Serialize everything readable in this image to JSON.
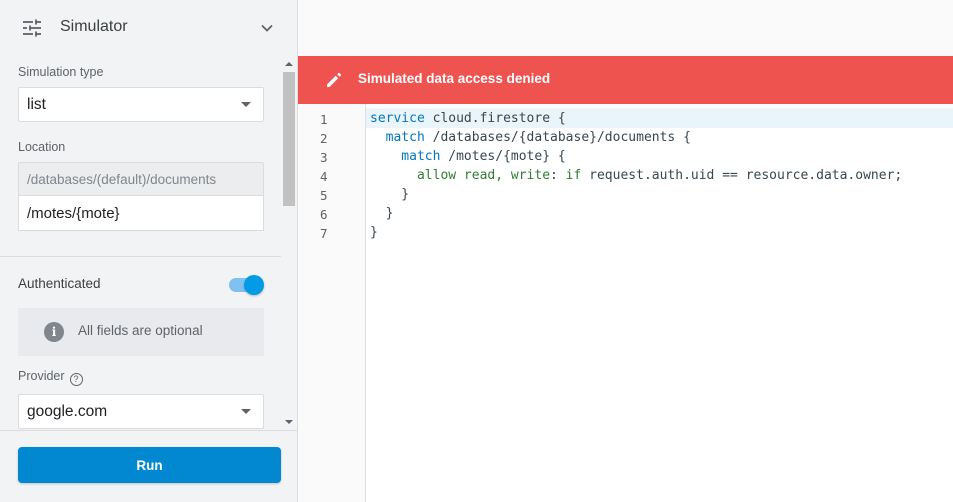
{
  "simulator": {
    "title": "Simulator",
    "simulation_type_label": "Simulation type",
    "simulation_type_value": "list",
    "location_label": "Location",
    "location_prefix": "/databases/(default)/documents",
    "location_path": "/motes/{mote}",
    "authenticated_label": "Authenticated",
    "authenticated": true,
    "optional_note": "All fields are optional",
    "provider_label": "Provider",
    "provider_value": "google.com",
    "run_label": "Run"
  },
  "banner": {
    "message": "Simulated data access denied",
    "color": "#ef5350"
  },
  "editor": {
    "line_numbers": [
      "1",
      "2",
      "3",
      "4",
      "5",
      "6",
      "7"
    ],
    "lines": [
      [
        "service",
        " cloud.firestore {"
      ],
      [
        "  match",
        " /databases/{database}/documents {"
      ],
      [
        "    match",
        " /motes/{mote} {"
      ],
      [
        "      allow",
        " ",
        "read, write",
        ": ",
        "if",
        " request.auth.uid == resource.data.owner;"
      ],
      [
        "    }"
      ],
      [
        "  }"
      ],
      [
        "}"
      ]
    ]
  },
  "colors": {
    "accent": "#0288d1",
    "toggle_on": "#039be5"
  }
}
